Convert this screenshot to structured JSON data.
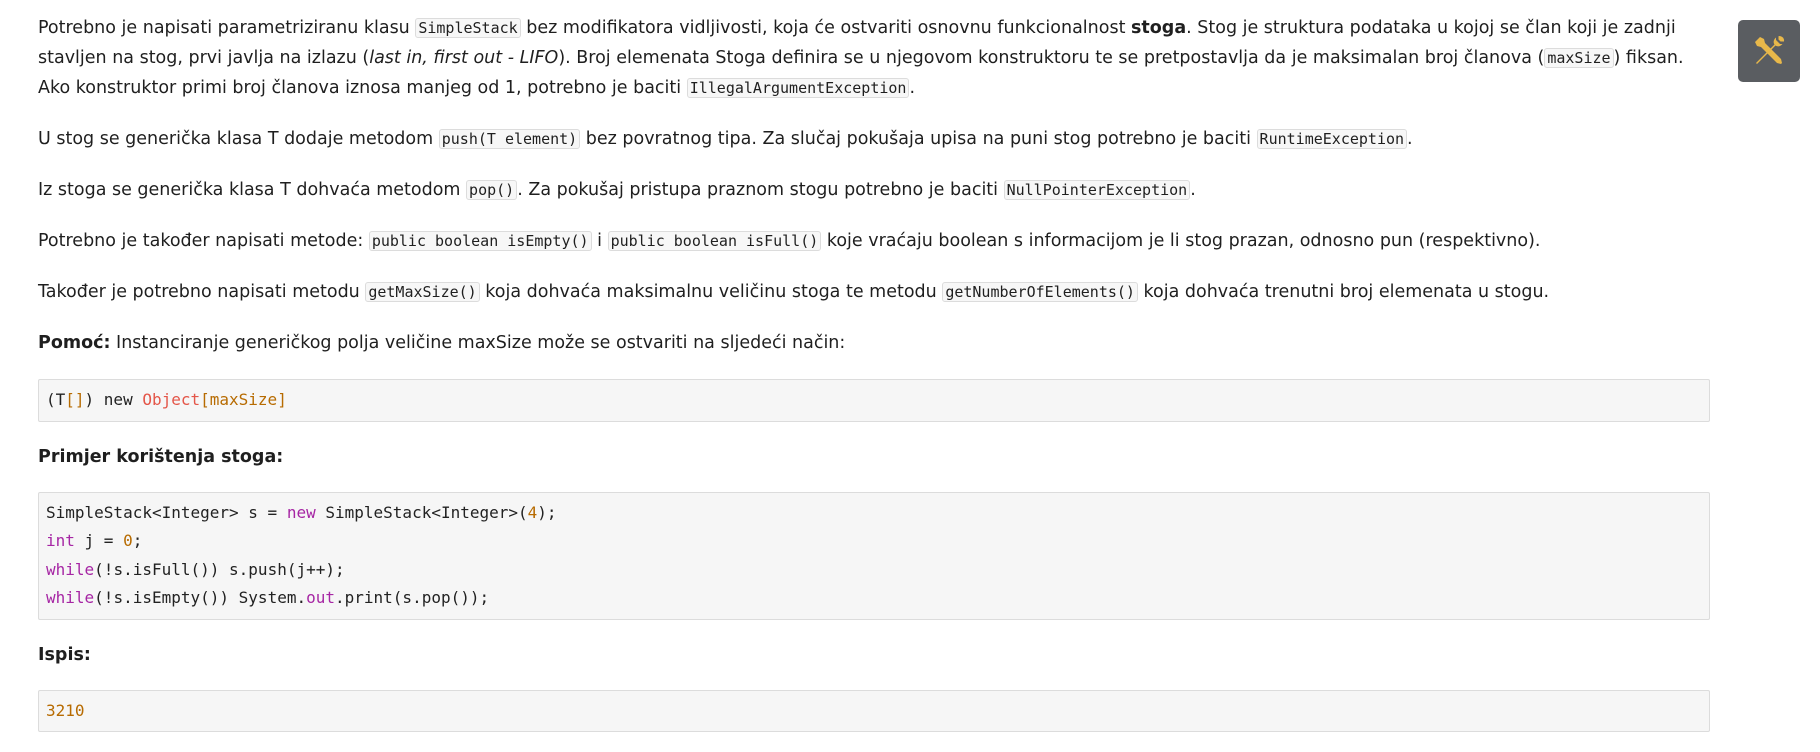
{
  "p1": {
    "t1": "Potrebno je napisati parametriziranu klasu ",
    "c1": "SimpleStack",
    "t2": " bez modifikatora vidljivosti, koja će ostvariti osnovnu funkcionalnost ",
    "b1": "stoga",
    "t3": ". Stog je struktura podataka u kojoj se član koji je zadnji stavljen na stog, prvi javlja na izlazu (",
    "i1": "last in, first out - LIFO",
    "t4": "). Broj elemenata Stoga definira se u njegovom konstruktoru te se pretpostavlja da je maksimalan broj članova (",
    "c2": "maxSize",
    "t5": ") fiksan. Ako konstruktor primi broj članova iznosa manjeg od 1, potrebno je baciti ",
    "c3": "IllegalArgumentException",
    "t6": "."
  },
  "p2": {
    "t1": "U stog se generička klasa T dodaje metodom ",
    "c1": "push(T element)",
    "t2": " bez povratnog tipa. Za slučaj pokušaja upisa na puni stog potrebno je baciti ",
    "c2": "RuntimeException",
    "t3": "."
  },
  "p3": {
    "t1": "Iz stoga se generička klasa T dohvaća metodom ",
    "c1": "pop()",
    "t2": ". Za pokušaj pristupa praznom stogu potrebno je baciti ",
    "c2": "NullPointerException",
    "t3": "."
  },
  "p4": {
    "t1": "Potrebno je također napisati metode: ",
    "c1": "public boolean isEmpty()",
    "t2": " i ",
    "c2": "public boolean isFull()",
    "t3": " koje vraćaju boolean s informacijom je li stog prazan, odnosno pun (respektivno)."
  },
  "p5": {
    "t1": "Također je potrebno napisati metodu ",
    "c1": "getMaxSize()",
    "t2": " koja dohvaća maksimalnu veličinu stoga te metodu ",
    "c2": "getNumberOfElements()",
    "t3": " koja dohvaća trenutni broj elemenata u stogu."
  },
  "p6": {
    "b1": "Pomoć:",
    "t1": " Instanciranje generičkog polja veličine maxSize može se ostvariti na sljedeći način:"
  },
  "code1": {
    "a": "(T",
    "b": "[]",
    "c": ") new ",
    "d": "Object",
    "e": "[maxSize]"
  },
  "heading_example": "Primjer korištenja stoga:",
  "code2": {
    "l1a": "SimpleStack<Integer> s = ",
    "l1b": "new",
    "l1c": " SimpleStack<Integer>(",
    "l1d": "4",
    "l1e": ");",
    "l2a": "int",
    "l2b": " j = ",
    "l2c": "0",
    "l2d": ";",
    "l3a": "while",
    "l3b": "(!s.isFull()) s.push(j++);",
    "l4a": "while",
    "l4b": "(!s.isEmpty()) System.",
    "l4c": "out",
    "l4d": ".print(s.pop());"
  },
  "heading_output": "Ispis:",
  "output": "3210",
  "toolbar": {
    "icon": "tools-icon",
    "icon_color": "#e8b84a"
  }
}
